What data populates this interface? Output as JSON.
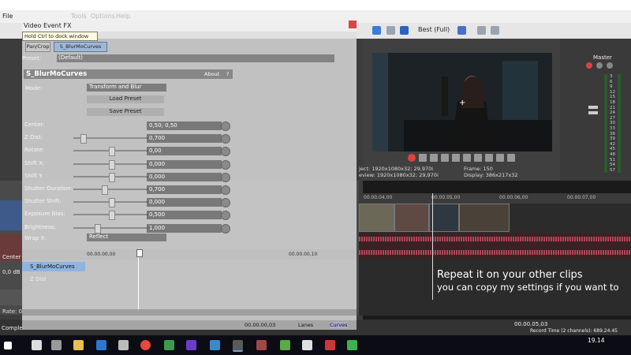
{
  "menubar": {
    "file_label": "File",
    "items": [
      "Tools",
      "Options",
      "Help"
    ]
  },
  "fx_window": {
    "title": "Video Event FX",
    "tooltip": "Hold Ctrl to dock window",
    "tabs": [
      "Pan/Crop",
      "S_BlurMoCurves"
    ],
    "preset_label": "Preset:",
    "preset_value": "(Default)",
    "plugin_title": "S_BlurMoCurves",
    "about_label": "About",
    "help_label": "?",
    "mode_label": "Mode:",
    "mode_value": "Transform and Blur",
    "load_preset": "Load Preset",
    "save_preset": "Save Preset",
    "params": [
      {
        "label": "Center:",
        "value": "0,50; 0,50",
        "slider": null
      },
      {
        "label": "Z Dist:",
        "value": "0,700",
        "slider": 0.1
      },
      {
        "label": "Rotate:",
        "value": "0,00",
        "slider": 0.5
      },
      {
        "label": "Shift X:",
        "value": "0,000",
        "slider": 0.5
      },
      {
        "label": "Shift Y:",
        "value": "0,000",
        "slider": 0.5
      },
      {
        "label": "Shutter Duration:",
        "value": "0,700",
        "slider": 0.4
      },
      {
        "label": "Shutter Shift:",
        "value": "0,000",
        "slider": 0.5
      },
      {
        "label": "Exposure Bias:",
        "value": "0,500",
        "slider": 0.5
      },
      {
        "label": "Brightness:",
        "value": "1,000",
        "slider": 0.3
      }
    ],
    "wrap_label": "Wrap X:",
    "wrap_value": "Reflect",
    "keyframe_track": "S_BlurMoCurves",
    "keyframe_sub": "Z Dist",
    "keyframe_time_1": "00.00.00,00",
    "keyframe_time_2": "00.00.00,10",
    "keyframe_time_3": "00.00.00,03",
    "lanes_label": "Lanes",
    "curves_label": "Curves"
  },
  "preview": {
    "quality": "Best (Full)",
    "project": "1920x1080x32; 29,970i",
    "preview_res": "1920x1080x32; 29,970i",
    "frame_label": "Frame:",
    "frame_value": "150",
    "display_label": "Display:",
    "display_value": "386x217x32",
    "project_label": "ject:",
    "preview_label": "eview:"
  },
  "master": {
    "title": "Master",
    "meter_ticks": [
      "3",
      "6",
      "9",
      "12",
      "15",
      "18",
      "21",
      "24",
      "27",
      "30",
      "33",
      "36",
      "39",
      "42",
      "45",
      "48",
      "51",
      "54",
      "57"
    ]
  },
  "timeline": {
    "ruler": [
      "00.00.04,00",
      "00.00.05,00",
      "00.00.06,00",
      "00.00.07,00"
    ],
    "rate_label": "Rate: 0",
    "db_label": "0,0 dB",
    "center_label": "Center",
    "current_time": "00.00.05,03",
    "record_time": "Record Time (2 channels): 689.24.45",
    "complete_label": "Complet"
  },
  "caption": {
    "line1": "Repeat it on your other clips",
    "line2": "you can copy my settings if you want to"
  },
  "taskbar": {
    "clock": "19.14"
  }
}
